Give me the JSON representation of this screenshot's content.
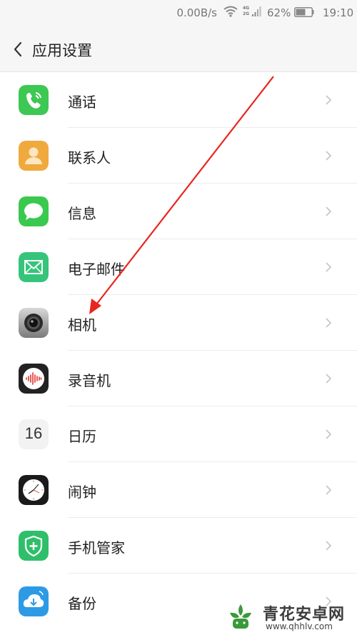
{
  "status_bar": {
    "net_speed": "0.00B/s",
    "network_top": "4G",
    "network_bottom": "2G",
    "battery_percent": "62%",
    "time": "19:10",
    "battery_level": 0.62
  },
  "header": {
    "title": "应用设置",
    "back_icon": "chevron-left-icon"
  },
  "items": [
    {
      "label": "通话",
      "icon": "phone-icon",
      "color": "#3cc852"
    },
    {
      "label": "联系人",
      "icon": "contacts-icon",
      "color": "#f0a93c"
    },
    {
      "label": "信息",
      "icon": "message-icon",
      "color": "#3ac94f"
    },
    {
      "label": "电子邮件",
      "icon": "mail-icon",
      "color": "#35c47a"
    },
    {
      "label": "相机",
      "icon": "camera-icon",
      "color": "#8a8a8a"
    },
    {
      "label": "录音机",
      "icon": "recorder-icon",
      "color": "#222222"
    },
    {
      "label": "日历",
      "icon": "calendar-icon",
      "color": "#f2f2f2",
      "day": "16"
    },
    {
      "label": "闹钟",
      "icon": "clock-icon",
      "color": "#1a1a1a"
    },
    {
      "label": "手机管家",
      "icon": "shield-icon",
      "color": "#2fbf6a"
    },
    {
      "label": "备份",
      "icon": "cloud-backup-icon",
      "color": "#2d9ae6"
    }
  ],
  "annotation": {
    "arrow_color": "#e8261f"
  },
  "watermark": {
    "name": "青花安卓网",
    "url": "www.qhhlv.com",
    "color": "#3a9a3a"
  }
}
